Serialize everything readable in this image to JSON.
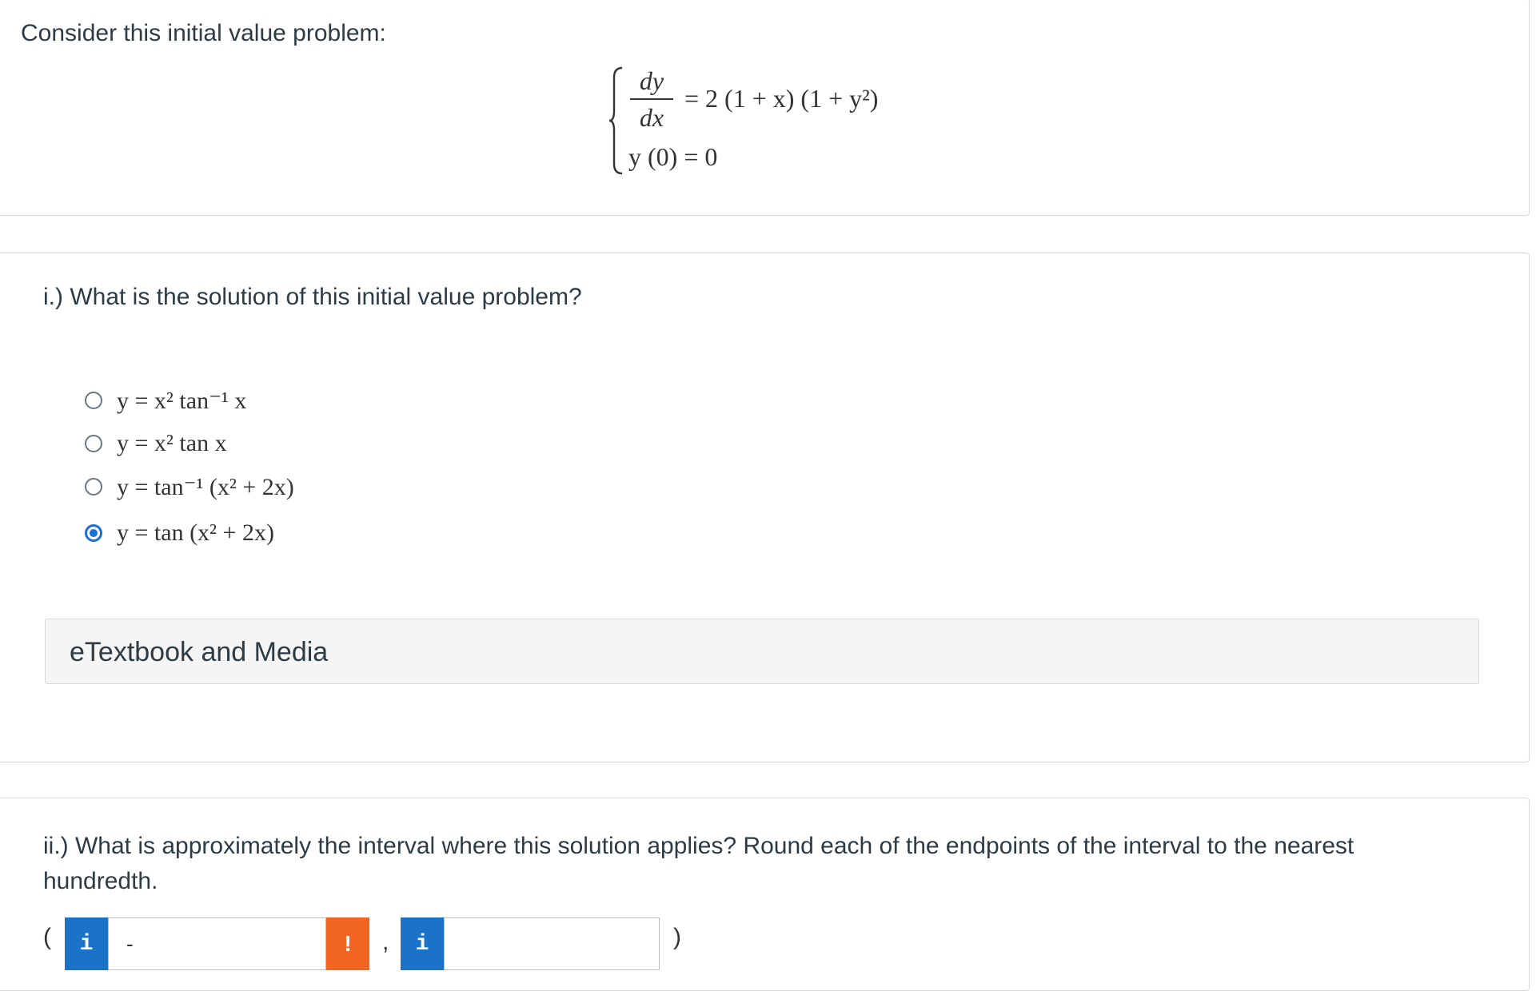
{
  "intro": {
    "prompt": "Consider this initial value problem:",
    "ode_numerator": "dy",
    "ode_denominator": "dx",
    "ode_rhs": "= 2 (1 + x) (1 + y²)",
    "initial_condition": "y (0) = 0"
  },
  "part1": {
    "prompt": "i.) What is the solution of this initial value problem?",
    "choices": [
      {
        "label": "y = x² tan⁻¹ x",
        "selected": false
      },
      {
        "label": "y = x² tan x",
        "selected": false
      },
      {
        "label": "y = tan⁻¹ (x² + 2x)",
        "selected": false
      },
      {
        "label": "y = tan (x² + 2x)",
        "selected": true
      }
    ],
    "media_label": "eTextbook and Media"
  },
  "part2": {
    "prompt": "ii.) What is approximately the interval where this solution applies? Round each of the endpoints of the interval to the nearest hundredth.",
    "open_paren": "(",
    "separator": ",",
    "close_paren": ")",
    "left_endpoint_value": "-",
    "right_endpoint_value": "",
    "info_icon": "i",
    "warning_icon": "!",
    "colors": {
      "info": "#1a73c7",
      "warning": "#f26522",
      "selected_radio": "#1b6fd6"
    }
  }
}
